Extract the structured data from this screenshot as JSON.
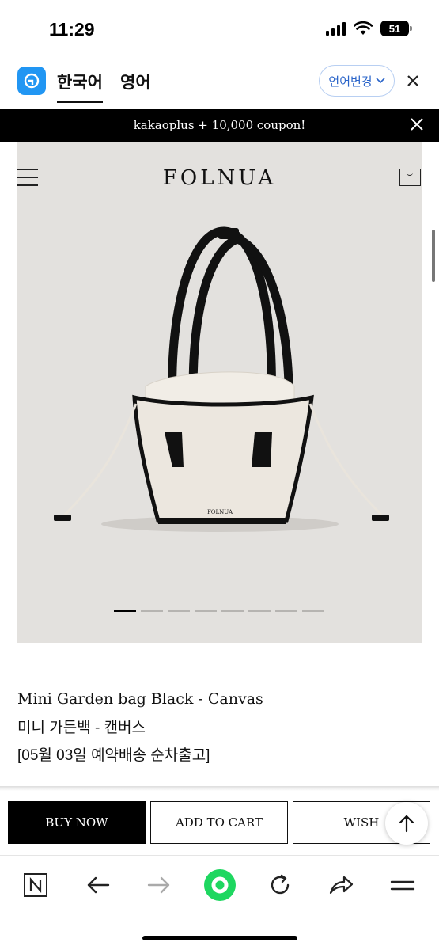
{
  "status_bar": {
    "time": "11:29",
    "battery": "51"
  },
  "translate_bar": {
    "lang_korean": "한국어",
    "lang_english": "영어",
    "change_lang": "언어변경"
  },
  "banner": {
    "text": "kakaoplus + 10,000 coupon!"
  },
  "header": {
    "brand": "FOLNUA"
  },
  "hero": {
    "bag_label": "FOLNUA",
    "slides": 8,
    "active_slide": 1
  },
  "product": {
    "name_en": "Mini Garden bag Black - Canvas",
    "name_ko": "미니 가든백 - 캔버스",
    "shipping_note": "[05월 03일 예약배송 순차출고]"
  },
  "actions": {
    "buy_now": "BUY NOW",
    "add_to_cart": "ADD TO CART",
    "wish": "WISH"
  },
  "colors": {
    "accent_blue": "#2196f3",
    "browser_green": "#1ed760",
    "banner_bg": "#000000"
  }
}
